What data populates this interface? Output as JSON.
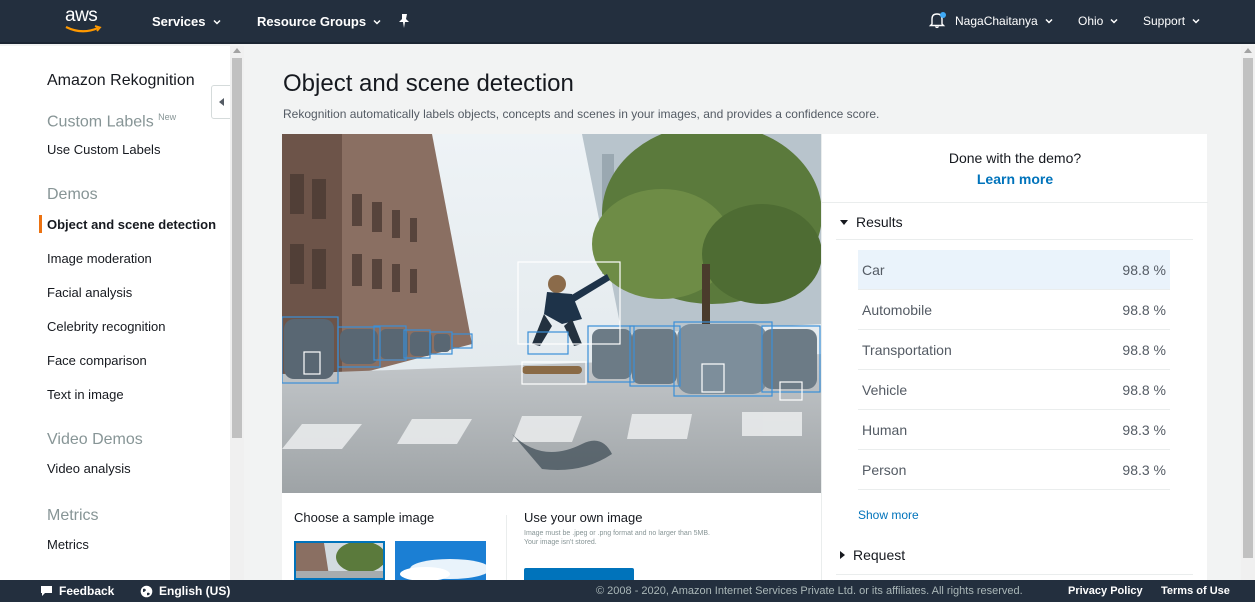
{
  "topnav": {
    "logo_text": "aws",
    "services": "Services",
    "resource_groups": "Resource Groups",
    "user": "NagaChaitanya",
    "region": "Ohio",
    "support": "Support"
  },
  "sidebar": {
    "title": "Amazon Rekognition",
    "custom_labels_section": "Custom Labels",
    "new_badge": "New",
    "use_custom_labels": "Use Custom Labels",
    "demos_section": "Demos",
    "demo_items": [
      "Object and scene detection",
      "Image moderation",
      "Facial analysis",
      "Celebrity recognition",
      "Face comparison",
      "Text in image"
    ],
    "video_section": "Video Demos",
    "video_item": "Video analysis",
    "metrics_section": "Metrics",
    "metrics_item": "Metrics"
  },
  "main": {
    "title": "Object and scene detection",
    "subtitle": "Rekognition automatically labels objects, concepts and scenes in your images, and provides a confidence score.",
    "choose_sample": "Choose a sample image",
    "use_own": "Use your own image",
    "own_note": "Image must be .jpeg or .png format and no larger than 5MB. Your image isn't stored."
  },
  "panel": {
    "done_text": "Done with the demo?",
    "learn_more": "Learn more",
    "results_label": "Results",
    "results": [
      {
        "label": "Car",
        "confidence": "98.8 %"
      },
      {
        "label": "Automobile",
        "confidence": "98.8 %"
      },
      {
        "label": "Transportation",
        "confidence": "98.8 %"
      },
      {
        "label": "Vehicle",
        "confidence": "98.8 %"
      },
      {
        "label": "Human",
        "confidence": "98.3 %"
      },
      {
        "label": "Person",
        "confidence": "98.3 %"
      }
    ],
    "show_more": "Show more",
    "request_label": "Request"
  },
  "footer": {
    "feedback": "Feedback",
    "language": "English (US)",
    "copyright": "© 2008 - 2020, Amazon Internet Services Private Ltd. or its affiliates. All rights reserved.",
    "privacy": "Privacy Policy",
    "terms": "Terms of Use"
  },
  "colors": {
    "nav_bg": "#232f3e",
    "accent_orange": "#ec7211",
    "link_blue": "#0073bb",
    "selected_row": "#eaf3fb",
    "bounding_box": "#3a8fd8"
  }
}
